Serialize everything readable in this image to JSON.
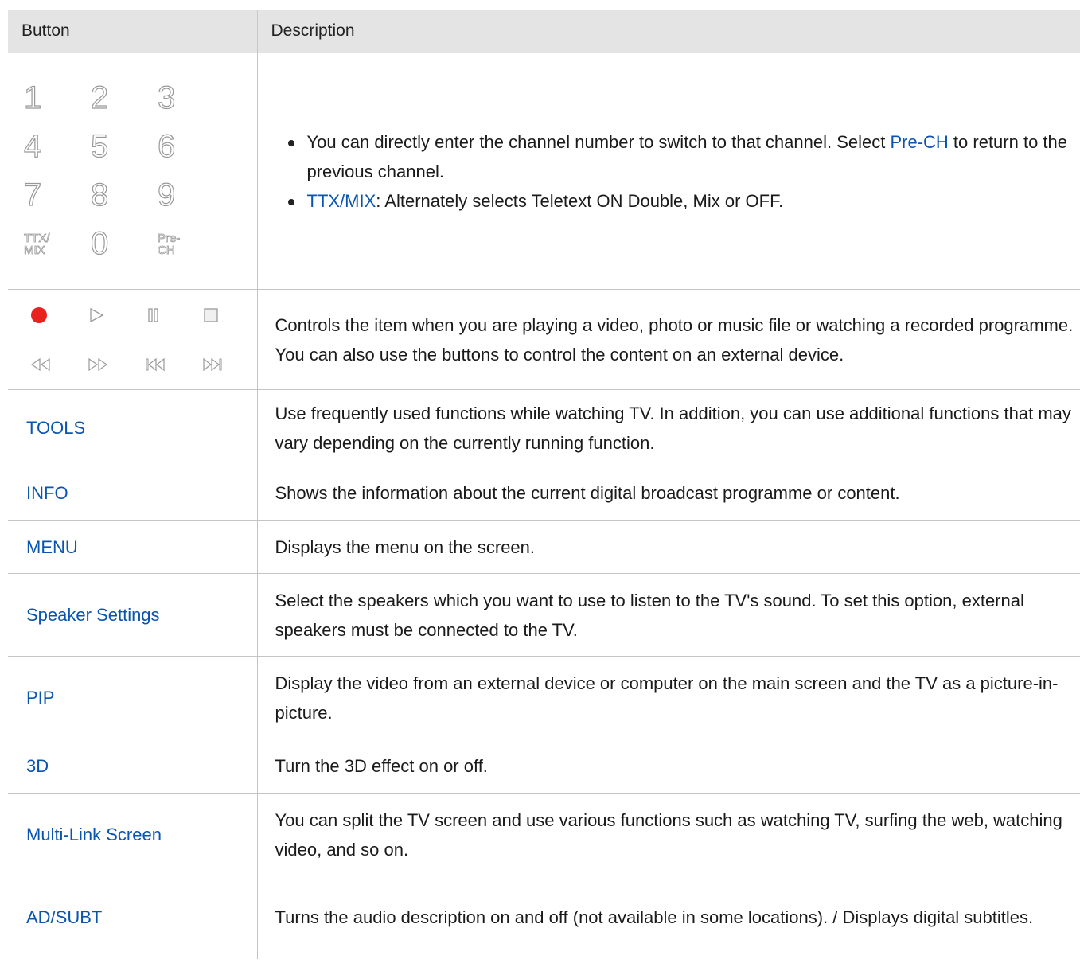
{
  "header": {
    "col_button": "Button",
    "col_description": "Description"
  },
  "numpad": {
    "keys": [
      "1",
      "2",
      "3",
      "4",
      "5",
      "6",
      "7",
      "8",
      "9",
      "TTX/\nMIX",
      "0",
      "Pre-\nCH"
    ],
    "bullet1_a": "You can directly enter the channel number to switch to that channel. Select ",
    "bullet1_link": "Pre-CH",
    "bullet1_b": " to return to the previous channel.",
    "bullet2_link": "TTX/MIX",
    "bullet2_b": ": Alternately selects Teletext ON Double, Mix or OFF."
  },
  "media": {
    "icons": [
      "record-icon",
      "play-icon",
      "pause-icon",
      "stop-icon",
      "rewind-icon",
      "fast-forward-icon",
      "skip-back-icon",
      "skip-forward-icon"
    ],
    "description": "Controls the item when you are playing a video, photo or music file or watching a recorded programme. You can also use the buttons to control the content on an external device."
  },
  "rows": [
    {
      "button": "TOOLS",
      "description": "Use frequently used functions while watching TV. In addition, you can use additional functions that may vary depending on the currently running function."
    },
    {
      "button": "INFO",
      "description": "Shows the information about the current digital broadcast programme or content."
    },
    {
      "button": "MENU",
      "description": "Displays the menu on the screen."
    },
    {
      "button": "Speaker Settings",
      "description": "Select the speakers which you want to use to listen to the TV's sound. To set this option, external speakers must be connected to the TV."
    },
    {
      "button": "PIP",
      "description": "Display the video from an external device or computer on the main screen and the TV as a picture-in-picture."
    },
    {
      "button": "3D",
      "description": "Turn the 3D effect on or off."
    },
    {
      "button": "Multi-Link Screen",
      "description": "You can split the TV screen and use various functions such as watching TV, surfing the web, watching video, and so on."
    },
    {
      "button": "AD/SUBT",
      "description": "Turns the audio description on and off (not available in some locations). / Displays digital subtitles."
    }
  ],
  "colors": {
    "link": "#0a55b0",
    "header_bg": "#e4e4e4",
    "record": "#e8231f",
    "icon_gray": "#9a9a9a"
  }
}
